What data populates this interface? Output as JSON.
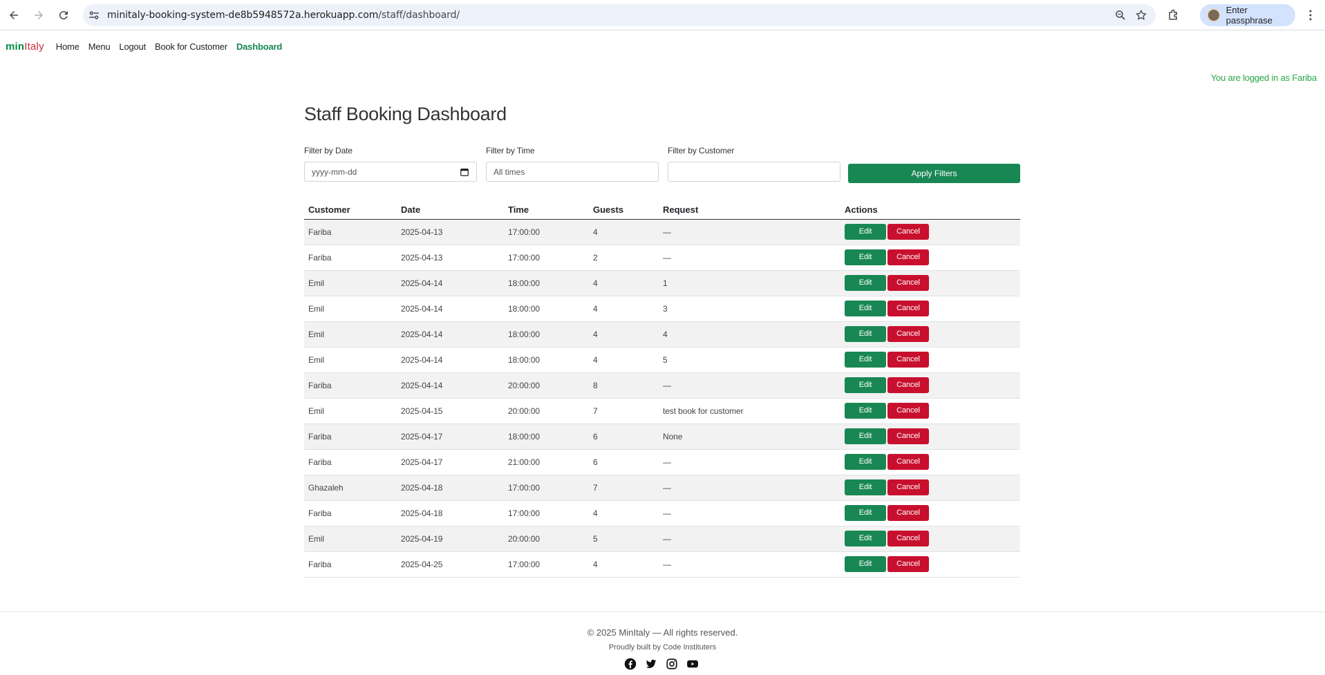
{
  "browser": {
    "url_host": "minitaly-booking-system-de8b5948572a.herokuapp.com",
    "url_path": "/staff/dashboard/",
    "profile_label": "Enter passphrase"
  },
  "site": {
    "brand_part1": "min",
    "brand_part2": "Italy",
    "nav": {
      "home": "Home",
      "menu": "Menu",
      "logout": "Logout",
      "book_for_customer": "Book for Customer",
      "dashboard": "Dashboard"
    },
    "logged_in_text": "You are logged in as Fariba"
  },
  "dashboard": {
    "title": "Staff Booking Dashboard",
    "filters": {
      "date_label": "Filter by Date",
      "date_placeholder": "yyyy-mm-dd",
      "time_label": "Filter by Time",
      "time_value": "All times",
      "customer_label": "Filter by Customer",
      "customer_value": "",
      "apply_label": "Apply Filters"
    },
    "table": {
      "headers": [
        "Customer",
        "Date",
        "Time",
        "Guests",
        "Request",
        "Actions"
      ],
      "edit_label": "Edit",
      "cancel_label": "Cancel",
      "rows": [
        [
          "Fariba",
          "2025-04-13",
          "17:00:00",
          "4",
          "—"
        ],
        [
          "Fariba",
          "2025-04-13",
          "17:00:00",
          "2",
          "—"
        ],
        [
          "Emil",
          "2025-04-14",
          "18:00:00",
          "4",
          "1"
        ],
        [
          "Emil",
          "2025-04-14",
          "18:00:00",
          "4",
          "3"
        ],
        [
          "Emil",
          "2025-04-14",
          "18:00:00",
          "4",
          "4"
        ],
        [
          "Emil",
          "2025-04-14",
          "18:00:00",
          "4",
          "5"
        ],
        [
          "Fariba",
          "2025-04-14",
          "20:00:00",
          "8",
          "—"
        ],
        [
          "Emil",
          "2025-04-15",
          "20:00:00",
          "7",
          "test book for customer"
        ],
        [
          "Fariba",
          "2025-04-17",
          "18:00:00",
          "6",
          "None"
        ],
        [
          "Fariba",
          "2025-04-17",
          "21:00:00",
          "6",
          "—"
        ],
        [
          "Ghazaleh",
          "2025-04-18",
          "17:00:00",
          "7",
          "—"
        ],
        [
          "Fariba",
          "2025-04-18",
          "17:00:00",
          "4",
          "—"
        ],
        [
          "Emil",
          "2025-04-19",
          "20:00:00",
          "5",
          "—"
        ],
        [
          "Fariba",
          "2025-04-25",
          "17:00:00",
          "4",
          "—"
        ]
      ]
    }
  },
  "footer": {
    "copyright": "© 2025 MinItaly — All rights reserved.",
    "credit": "Proudly built by Code Instituters",
    "social_icons": [
      "facebook-icon",
      "twitter-icon",
      "instagram-icon",
      "youtube-icon"
    ]
  },
  "colors": {
    "brand_green": "#009246",
    "brand_red": "#ce2b37",
    "button_green": "#198754",
    "button_red": "#c8102e"
  }
}
